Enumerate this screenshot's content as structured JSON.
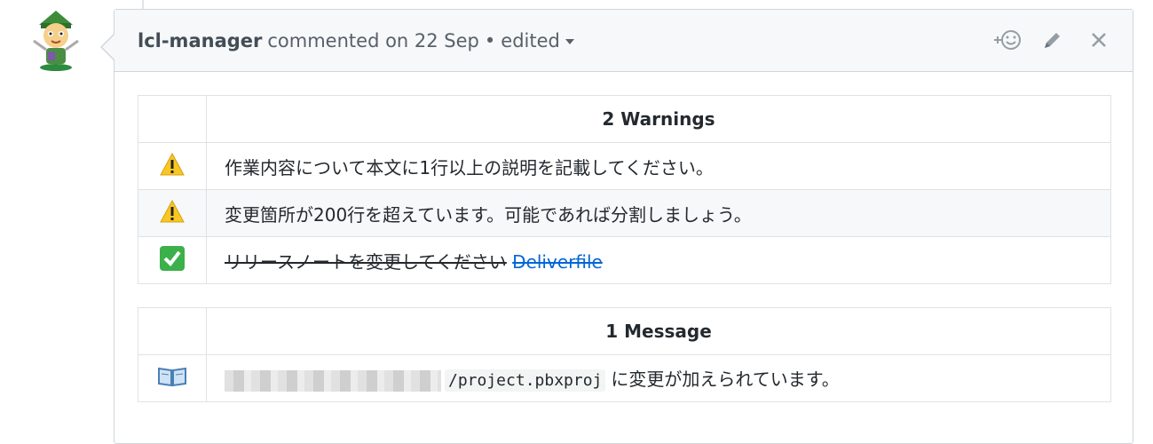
{
  "comment": {
    "author": "lcl-manager",
    "action": "commented on 22 Sep",
    "separator": "•",
    "edited_label": "edited"
  },
  "warnings_table": {
    "header": "2 Warnings",
    "rows": [
      {
        "icon": "warning-icon",
        "text": "作業内容について本文に1行以上の説明を記載してください。"
      },
      {
        "icon": "warning-icon",
        "text": "変更箇所が200行を超えています。可能であれば分割しましょう。"
      },
      {
        "icon": "check-icon",
        "text": "リリースノートを変更してください",
        "link": "Deliverfile"
      }
    ]
  },
  "messages_table": {
    "header": "1 Message",
    "rows": [
      {
        "icon": "book-icon",
        "code": "/project.pbxproj",
        "text": "に変更が加えられています。"
      }
    ]
  },
  "colors": {
    "link": "#0366d6",
    "warning": "#f9c622",
    "success": "#3cb04a"
  }
}
